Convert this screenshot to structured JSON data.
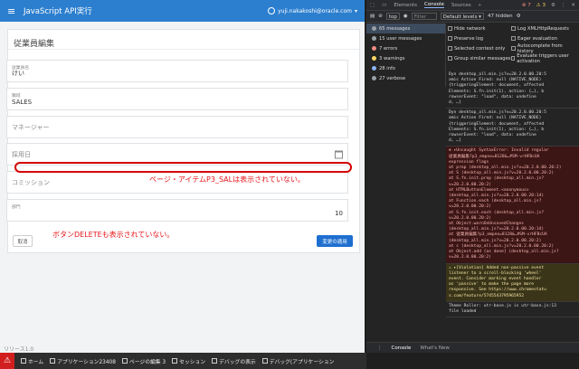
{
  "app": {
    "menu_icon": "hamburger-icon",
    "title": "JavaScript API実行",
    "user": "yuji.nakakoshi@oracle.com",
    "card_title": "従業員編集",
    "fields": {
      "name": {
        "label": "従業員名",
        "value": "けい"
      },
      "job": {
        "label": "職域",
        "value": "SALES"
      },
      "manager": {
        "placeholder": "マネージャー"
      },
      "hiredate": {
        "placeholder": "採用日"
      },
      "commission": {
        "placeholder": "コミッション"
      },
      "dept": {
        "label": "部門",
        "value": "10"
      }
    },
    "note_sal": "ページ・アイテムP3_SALは表示されていない。",
    "note_delete": "ボタンDELETEも表示されていない。",
    "cancel_label": "取消",
    "apply_label": "変更の適用",
    "release": "リリース1.0"
  },
  "devtools": {
    "tabs": [
      "Elements",
      "Console",
      "Sources"
    ],
    "active_tab": "Console",
    "more": "»",
    "error_count": "7",
    "warn_count": "3",
    "context": "top",
    "filter_placeholder": "Filter",
    "levels": "Default levels ▾",
    "hidden": "47 hidden",
    "sidebar": [
      {
        "label": "65 messages",
        "color": "#9aa0a6"
      },
      {
        "label": "15 user messages",
        "color": "#9aa0a6"
      },
      {
        "label": "7 errors",
        "color": "#f28b82"
      },
      {
        "label": "3 warnings",
        "color": "#fdd663"
      },
      {
        "label": "28 info",
        "color": "#8ab4f8"
      },
      {
        "label": "27 verbose",
        "color": "#9aa0a6"
      }
    ],
    "settings": [
      [
        "Hide network",
        "Log XMLHttpRequests"
      ],
      [
        "Preserve log",
        "Eager evaluation"
      ],
      [
        "Selected context only",
        "Autocomplete from history"
      ],
      [
        "Group similar messages",
        "Evaluate triggers user activation"
      ]
    ],
    "log": [
      {
        "type": "info",
        "lines": [
          "Dyn desktop_all.min.js?v=20.2.0.00.20:5",
          "amic Action Fired: null (NATIVE_NODE)",
          "{triggeringElement: document, affected",
          "Elements: S.fn.init(1), action: {…}, b",
          "rowserEvent: \"load\", data: undefine",
          "d, …}"
        ]
      },
      {
        "type": "info",
        "lines": [
          "Dyn desktop_all.min.js?v=20.2.0.00.20:5",
          "amic Action Fired: null (NATIVE_NODE)",
          "{triggeringElement: document, affected",
          "Elements: S.fn.init(1), action: {…}, b",
          "rowserEvent: \"load\", data: undefine",
          "d, …}"
        ]
      },
      {
        "type": "err",
        "lines": [
          "⊗ ▸Uncaught SyntaxError: Invalid regular",
          "  従業員編集?p3_empno=8128&…#SM-vrHFBcUA",
          "  expression flags",
          "    at prop (desktop_all.min.js?v=20.2.0.00.20:2)",
          "    at S (desktop_all.min.js?v=20.2.0.00.20:2)",
          "    at S.fn.init.prop (desktop_all.min.js?v=20.2.0.00.20:2)",
          "    at HTMLButtonElement.<anonymous> (desktop_all.min.js?v=20.2.0.00.20:14)",
          "    at Function.each (desktop_all.min.js?v=20.2.0.00.20:2)",
          "    at S.fn.init.each (desktop_all.min.js?v=20.2.0.00.20:2)",
          "    at Object.warnOnUnsavedChanges (desktop_all.min.js?v=20.2.0.00.20:14)",
          "    at 従業員編集?p3_empno=8128&…#SM-vrHFBcUA (desktop_all.min.js?v=20.2.0.00.20:2)",
          "    at c (desktop_all.min.js?v=20.2.0.00.20:2)",
          "    at Object.add [as done] (desktop_all.min.js?v=20.2.0.00.20:2)"
        ]
      },
      {
        "type": "warn",
        "lines": [
          "⚠ ▸[Violation] Added non-passive event",
          "  listener to a scroll-blocking 'wheel'",
          "  event. Consider marking event handler",
          "  as 'passive' to make the page more",
          "  responsive. See https://www.chromestatu",
          "  s.com/feature/5745543795965952"
        ]
      },
      {
        "type": "info",
        "lines": [
          "Theme Roller: utr-base.js is    utr-base.js:13",
          "file loaded"
        ]
      }
    ],
    "bottom_tabs": [
      "Console",
      "What's New"
    ]
  },
  "taskbar": {
    "warning_icon": "warning-icon",
    "items": [
      "ホーム",
      "アプリケーション23408",
      "ページの編集 3",
      "セッション",
      "デバッグの表示",
      "デバッグ(アプリケーション"
    ]
  }
}
